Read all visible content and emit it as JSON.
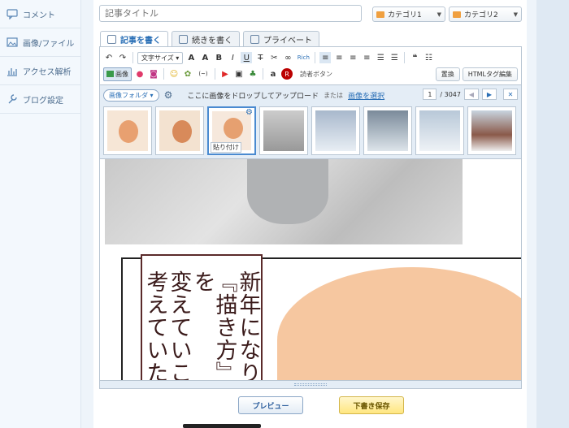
{
  "sidebar": {
    "items": [
      {
        "label": "コメント",
        "icon": "comment-icon"
      },
      {
        "label": "画像/ファイル",
        "icon": "image-icon"
      },
      {
        "label": "アクセス解析",
        "icon": "chart-icon"
      },
      {
        "label": "ブログ設定",
        "icon": "wrench-icon"
      }
    ]
  },
  "header": {
    "title_placeholder": "記事タイトル",
    "category1": "カテゴリ1",
    "category2": "カテゴリ2"
  },
  "tabs": [
    {
      "label": "記事を書く",
      "active": true
    },
    {
      "label": "続きを書く",
      "active": false
    },
    {
      "label": "プライベート",
      "active": false
    }
  ],
  "toolbar": {
    "font_size_label": "文字サイズ",
    "rich_label": "Rich",
    "image_button": "画像",
    "reader_button": "読者ボタン",
    "replace_button": "置換",
    "html_edit_button": "HTMLタグ編集"
  },
  "image_panel": {
    "folder_label": "画像フォルダ",
    "drop_text": "ここに画像をドロップしてアップロード",
    "or_text": "または",
    "select_link": "画像を選択",
    "page_current": "1",
    "page_total": "/ 3047",
    "paste_label": "貼り付け"
  },
  "content": {
    "manga_lines": [
      "新年になり",
      "『描き方』を",
      "変えていこ",
      "考えていた"
    ]
  },
  "actions": {
    "preview": "プレビュー",
    "save_draft": "下書き保存"
  },
  "colors": {
    "accent": "#2a6fb6",
    "draft_button": "#ffe680"
  }
}
